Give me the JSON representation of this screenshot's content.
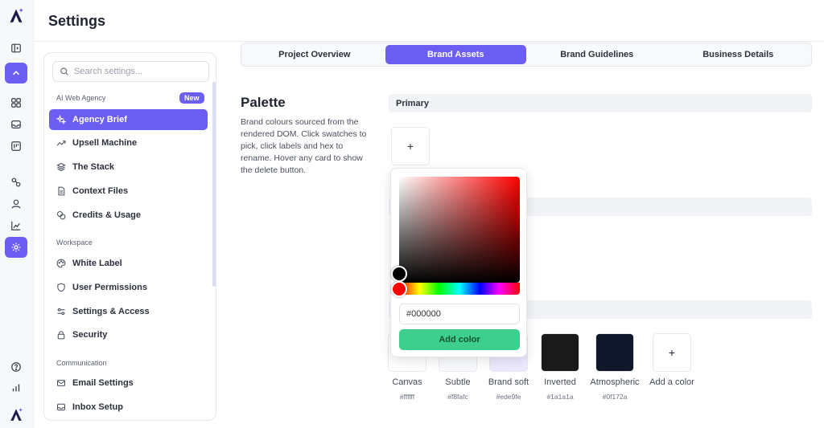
{
  "header": {
    "title": "Settings"
  },
  "rail": {
    "items": [
      "app-logo",
      "sidebar-toggle-icon",
      "collapse-up-icon",
      "grid-icon",
      "inbox-icon",
      "kanban-icon",
      "integrations-icon",
      "user-icon",
      "chart-icon",
      "settings-icon",
      "help-icon",
      "bar-chart-icon",
      "brand-logo"
    ]
  },
  "sidebar": {
    "search_placeholder": "Search settings...",
    "sections": [
      {
        "label": "AI Web Agency",
        "badge": "New",
        "items": [
          {
            "label": "Agency Brief",
            "icon": "sparkles-icon",
            "active": true
          },
          {
            "label": "Upsell Machine",
            "icon": "trend-up-icon"
          },
          {
            "label": "The Stack",
            "icon": "layers-icon"
          },
          {
            "label": "Context Files",
            "icon": "file-icon"
          },
          {
            "label": "Credits & Usage",
            "icon": "coins-icon"
          }
        ]
      },
      {
        "label": "Workspace",
        "items": [
          {
            "label": "White Label",
            "icon": "palette-icon"
          },
          {
            "label": "User Permissions",
            "icon": "shield-icon"
          },
          {
            "label": "Settings & Access",
            "icon": "sliders-icon"
          },
          {
            "label": "Security",
            "icon": "lock-icon"
          }
        ]
      },
      {
        "label": "Communication",
        "items": [
          {
            "label": "Email Settings",
            "icon": "mail-icon"
          },
          {
            "label": "Inbox Setup",
            "icon": "inbox-icon"
          }
        ]
      }
    ]
  },
  "tabs": [
    {
      "label": "Project Overview"
    },
    {
      "label": "Brand Assets",
      "active": true
    },
    {
      "label": "Brand Guidelines"
    },
    {
      "label": "Business Details"
    }
  ],
  "palette": {
    "title": "Palette",
    "description": "Brand colours sourced from the rendered DOM. Click swatches to pick, click labels and hex to rename. Hover any card to show the delete button.",
    "primary_label": "Primary",
    "add_symbol": "+",
    "add_color_label": "Add a color",
    "swatches": [
      {
        "label": "Canvas",
        "hex": "#ffffff"
      },
      {
        "label": "Subtle",
        "hex": "#f8fafc"
      },
      {
        "label": "Brand soft",
        "hex": "#ede9fe"
      },
      {
        "label": "Inverted",
        "hex": "#1a1a1a"
      },
      {
        "label": "Atmospheric",
        "hex": "#0f172a"
      }
    ]
  },
  "picker": {
    "hex_value": "#000000",
    "add_button": "Add color",
    "hue_color": "#ff0000"
  },
  "colors": {
    "accent": "#6d5ef3",
    "success": "#3ecf8e"
  }
}
